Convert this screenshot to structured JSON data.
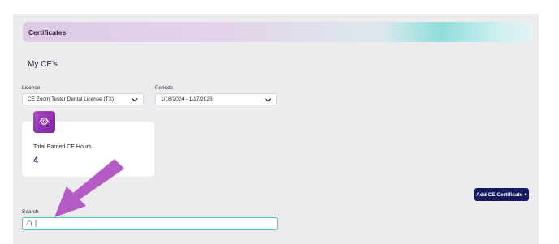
{
  "banner": {
    "title": "Certificates"
  },
  "page": {
    "title": "My CE's"
  },
  "filters": {
    "license_label": "License",
    "license_value": "CE Zoom Tester Dental License (TX)",
    "periods_label": "Periods",
    "periods_value": "1/18/2024 - 1/17/2026"
  },
  "summary_card": {
    "icon": "certificate-badge-icon",
    "label": "Total Earned CE Hours",
    "value": "4"
  },
  "actions": {
    "add_certificate_label": "Add CE Certificate +"
  },
  "search": {
    "label": "Search",
    "value": "",
    "placeholder": ""
  },
  "colors": {
    "accent_navy": "#141a5c",
    "card_icon_purple": "#9b3bbd",
    "search_border_teal": "#45c9c2",
    "annotation_arrow": "#b45bc6"
  },
  "annotation": {
    "type": "arrow",
    "points_to": "search-input"
  }
}
